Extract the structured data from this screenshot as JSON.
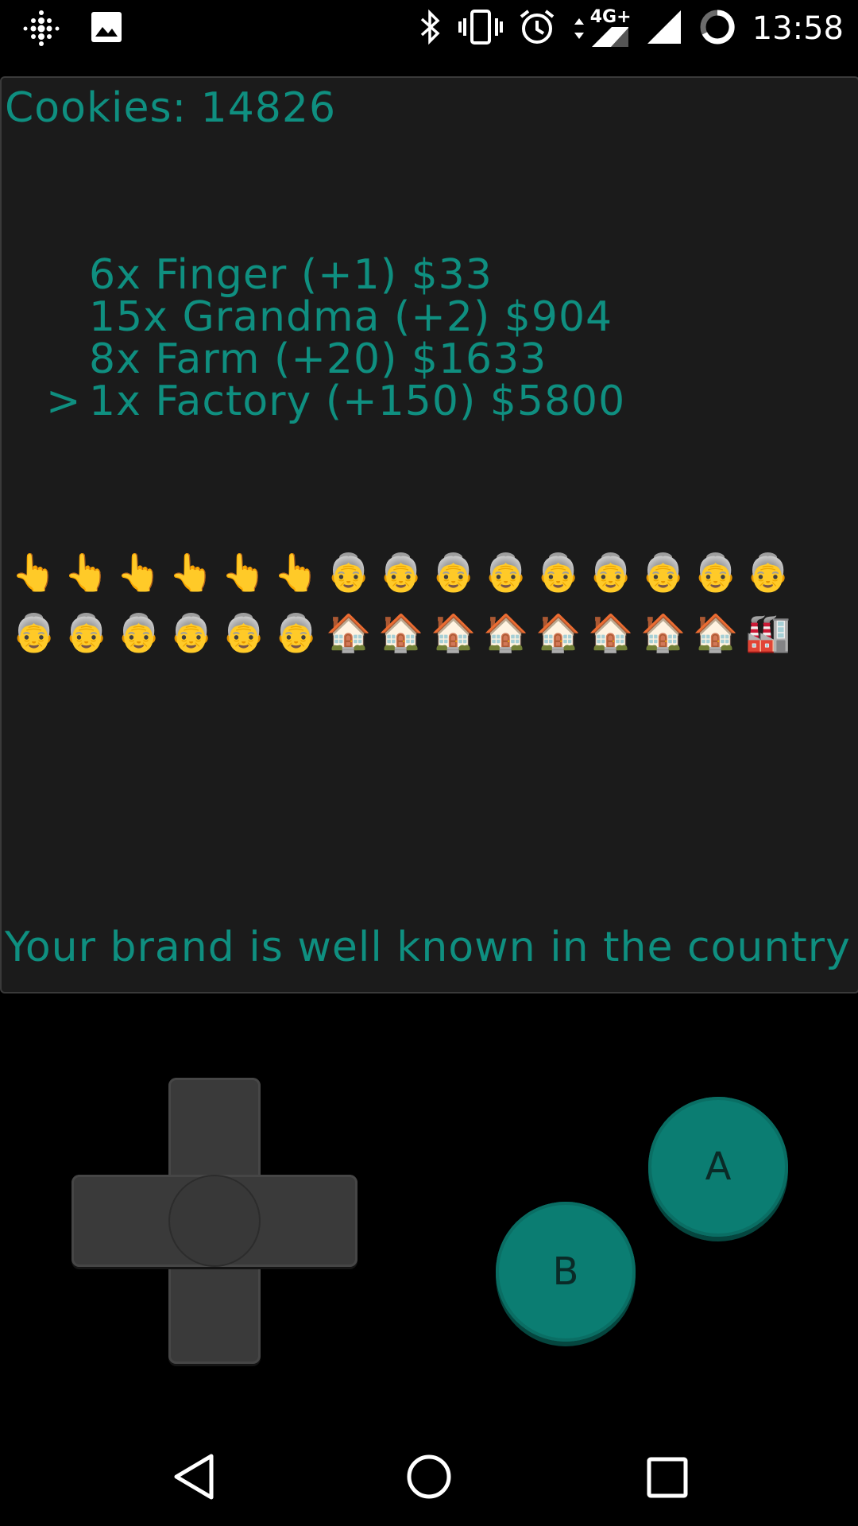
{
  "status_bar": {
    "time": "13:58",
    "network_label": "4G+",
    "icons": [
      "fitbit-icon",
      "image-icon",
      "bluetooth-icon",
      "vibrate-icon",
      "alarm-icon",
      "data-arrows-icon",
      "signal-4g-icon",
      "signal-icon",
      "battery-ring-icon"
    ]
  },
  "game": {
    "cookies_text": "Cookies: 14826",
    "shop_items": [
      {
        "label": "6x Finger (+1) $33",
        "selected": false
      },
      {
        "label": "15x Grandma (+2) $904",
        "selected": false
      },
      {
        "label": "8x Farm (+20) $1633",
        "selected": false
      },
      {
        "label": "1x Factory (+150) $5800",
        "selected": true
      }
    ],
    "cursor_symbol": ">",
    "owned_row_top": [
      "👆",
      "👆",
      "👆",
      "👆",
      "👆",
      "👆",
      "👵",
      "👵",
      "👵",
      "👵",
      "👵",
      "👵",
      "👵",
      "👵",
      "👵"
    ],
    "owned_row_bottom": [
      "👵",
      "👵",
      "👵",
      "👵",
      "👵",
      "👵",
      "🏠",
      "🏠",
      "🏠",
      "🏠",
      "🏠",
      "🏠",
      "🏠",
      "🏠",
      "🏭"
    ],
    "status_message": "Your brand is well known in the country",
    "text_color": "#0f8f80",
    "background_color": "#1b1b1b"
  },
  "controls": {
    "a_label": "A",
    "b_label": "B",
    "button_color": "#0b7d72",
    "dpad_color": "#3a3a3a"
  },
  "nav_bar": {
    "icons": [
      "back-icon",
      "home-icon",
      "recents-icon"
    ]
  }
}
